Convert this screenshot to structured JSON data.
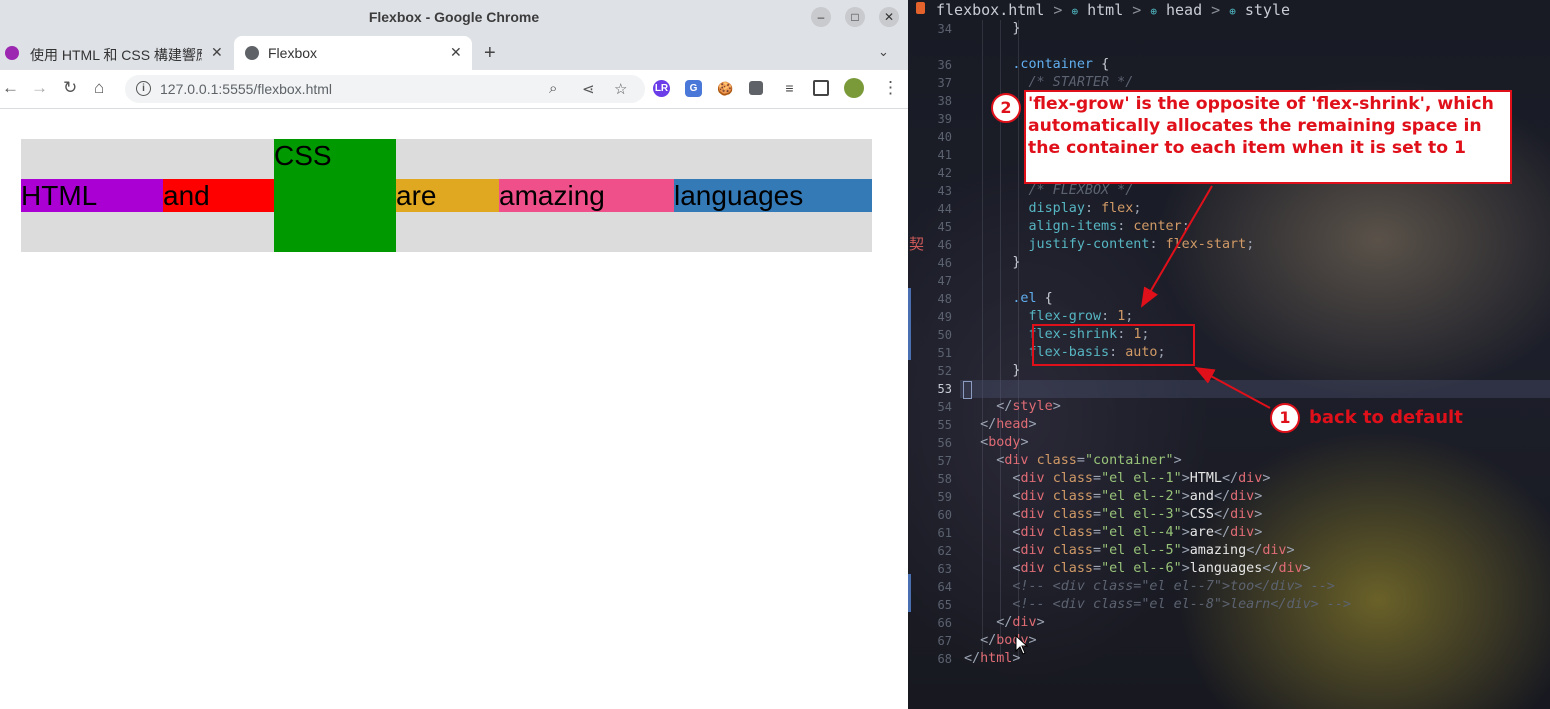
{
  "window": {
    "title": "Flexbox - Google Chrome",
    "minimize": "–",
    "maximize": "□",
    "close": "✕"
  },
  "tabs": [
    {
      "label": "使用 HTML 和 CSS 構建響應",
      "close": "✕",
      "active": false
    },
    {
      "label": "Flexbox",
      "close": "✕",
      "active": true
    }
  ],
  "new_tab": "+",
  "tab_search": "⌄",
  "nav": {
    "back": "←",
    "forward": "→",
    "reload": "↻",
    "home": "⌂"
  },
  "address": {
    "host": "127.0.0.1",
    "rest": ":5555/flexbox.html"
  },
  "omnibox_icons": [
    "zoom-icon",
    "share-icon",
    "bookmark-star-icon"
  ],
  "extensions": [
    "LR",
    "G",
    "🍪",
    "puzzle",
    "media",
    "sidepanel"
  ],
  "flex_items": [
    {
      "text": "HTML",
      "color": "#aa00d4",
      "width": 142
    },
    {
      "text": "and",
      "color": "#ff0000",
      "width": 111
    },
    {
      "text": "CSS",
      "color": "#009900",
      "width": 122
    },
    {
      "text": "are",
      "color": "#e0a820",
      "width": 103
    },
    {
      "text": "amazing",
      "color": "#f0508a",
      "width": 175
    },
    {
      "text": "languages",
      "color": "#337ab7",
      "width": 198
    }
  ],
  "editor": {
    "breadcrumb": {
      "file": "flexbox.html",
      "sep": ">",
      "n1": "html",
      "n2": "head",
      "n3": "style"
    },
    "annotation_main": "'flex-grow' is the opposite of 'flex-shrink', which automatically allocates the remaining space in the container to each item when it is set to 1",
    "step2": "2",
    "step1": "1",
    "step1_label": "back to default",
    "kanji": "契"
  }
}
